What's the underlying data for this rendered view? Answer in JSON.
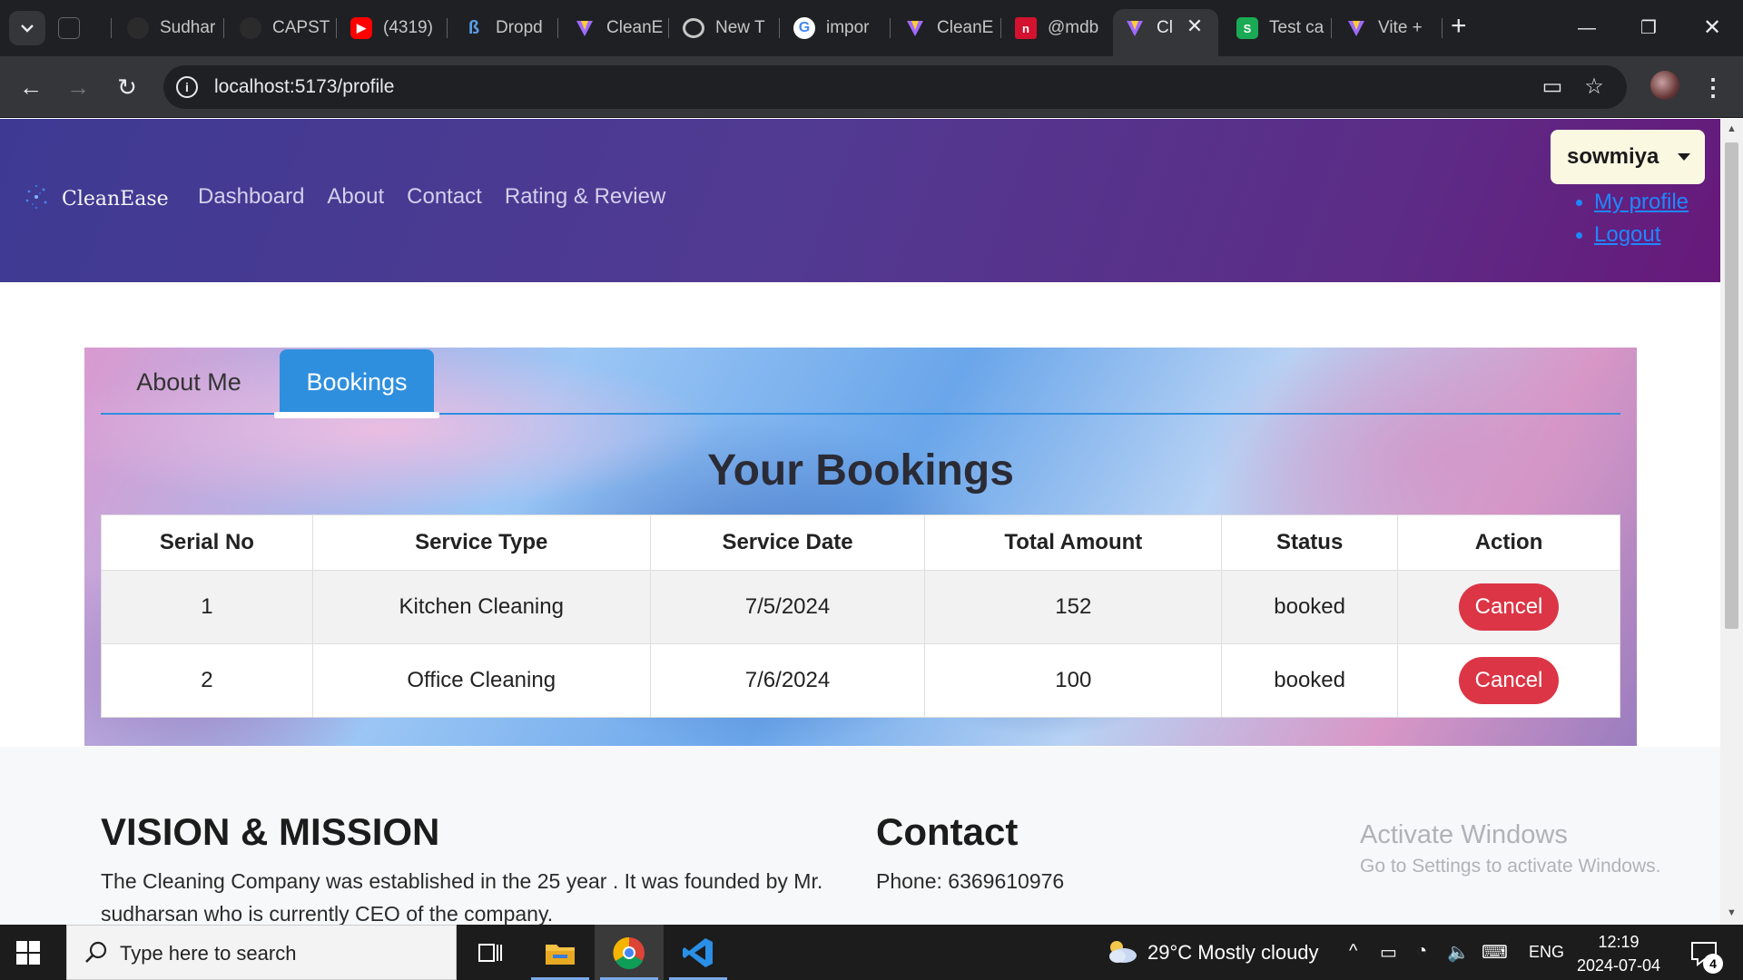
{
  "browser": {
    "tabs": [
      {
        "title": "",
        "icon": "window-icon"
      },
      {
        "title": "Sudhar",
        "icon": "github-icon"
      },
      {
        "title": "CAPST",
        "icon": "github-icon"
      },
      {
        "title": "(4319)",
        "icon": "youtube-icon"
      },
      {
        "title": "Dropd",
        "icon": "bootstrap-icon"
      },
      {
        "title": "CleanE",
        "icon": "vite-icon"
      },
      {
        "title": "New T",
        "icon": "chrome-icon"
      },
      {
        "title": "impor",
        "icon": "google-icon"
      },
      {
        "title": "CleanE",
        "icon": "vite-icon"
      },
      {
        "title": "@mdb",
        "icon": "mdb-icon"
      },
      {
        "title": "Cl",
        "icon": "vite-icon",
        "active": true
      },
      {
        "title": "Test ca",
        "icon": "s-icon"
      },
      {
        "title": "Vite +",
        "icon": "vite-icon"
      }
    ],
    "url": "localhost:5173/profile"
  },
  "site": {
    "logo_text": "CleanEase",
    "nav": [
      "Dashboard",
      "About",
      "Contact",
      "Rating & Review"
    ],
    "user": {
      "name": "sowmiya",
      "menu": [
        "My profile",
        "Logout"
      ]
    }
  },
  "profile": {
    "tabs": [
      "About Me",
      "Bookings"
    ],
    "active_tab": "Bookings",
    "title": "Your Bookings",
    "table": {
      "columns": [
        "Serial No",
        "Service Type",
        "Service Date",
        "Total Amount",
        "Status",
        "Action"
      ],
      "rows": [
        {
          "serial": "1",
          "service": "Kitchen Cleaning",
          "date": "7/5/2024",
          "amount": "152",
          "status": "booked",
          "action": "Cancel"
        },
        {
          "serial": "2",
          "service": "Office Cleaning",
          "date": "7/6/2024",
          "amount": "100",
          "status": "booked",
          "action": "Cancel"
        }
      ]
    }
  },
  "footer": {
    "vision_title": "VISION & MISSION",
    "vision_text_line1": "The Cleaning Company was established in the 25 year . It was founded by Mr.",
    "vision_text_line2": "sudharsan who is currently CEO of the company.",
    "contact_title": "Contact",
    "phone": "Phone: 6369610976"
  },
  "watermark": {
    "line1": "Activate Windows",
    "line2": "Go to Settings to activate Windows."
  },
  "taskbar": {
    "search_placeholder": "Type here to search",
    "weather": "29°C  Mostly cloudy",
    "language": "ENG",
    "time": "12:19",
    "date": "2024-07-04",
    "notifications": "4"
  },
  "colors": {
    "header_start": "#3e3a93",
    "header_end": "#67197a",
    "tab_active": "#2f8fdf",
    "cancel_button": "#dc3545",
    "link": "#1e88ff"
  }
}
